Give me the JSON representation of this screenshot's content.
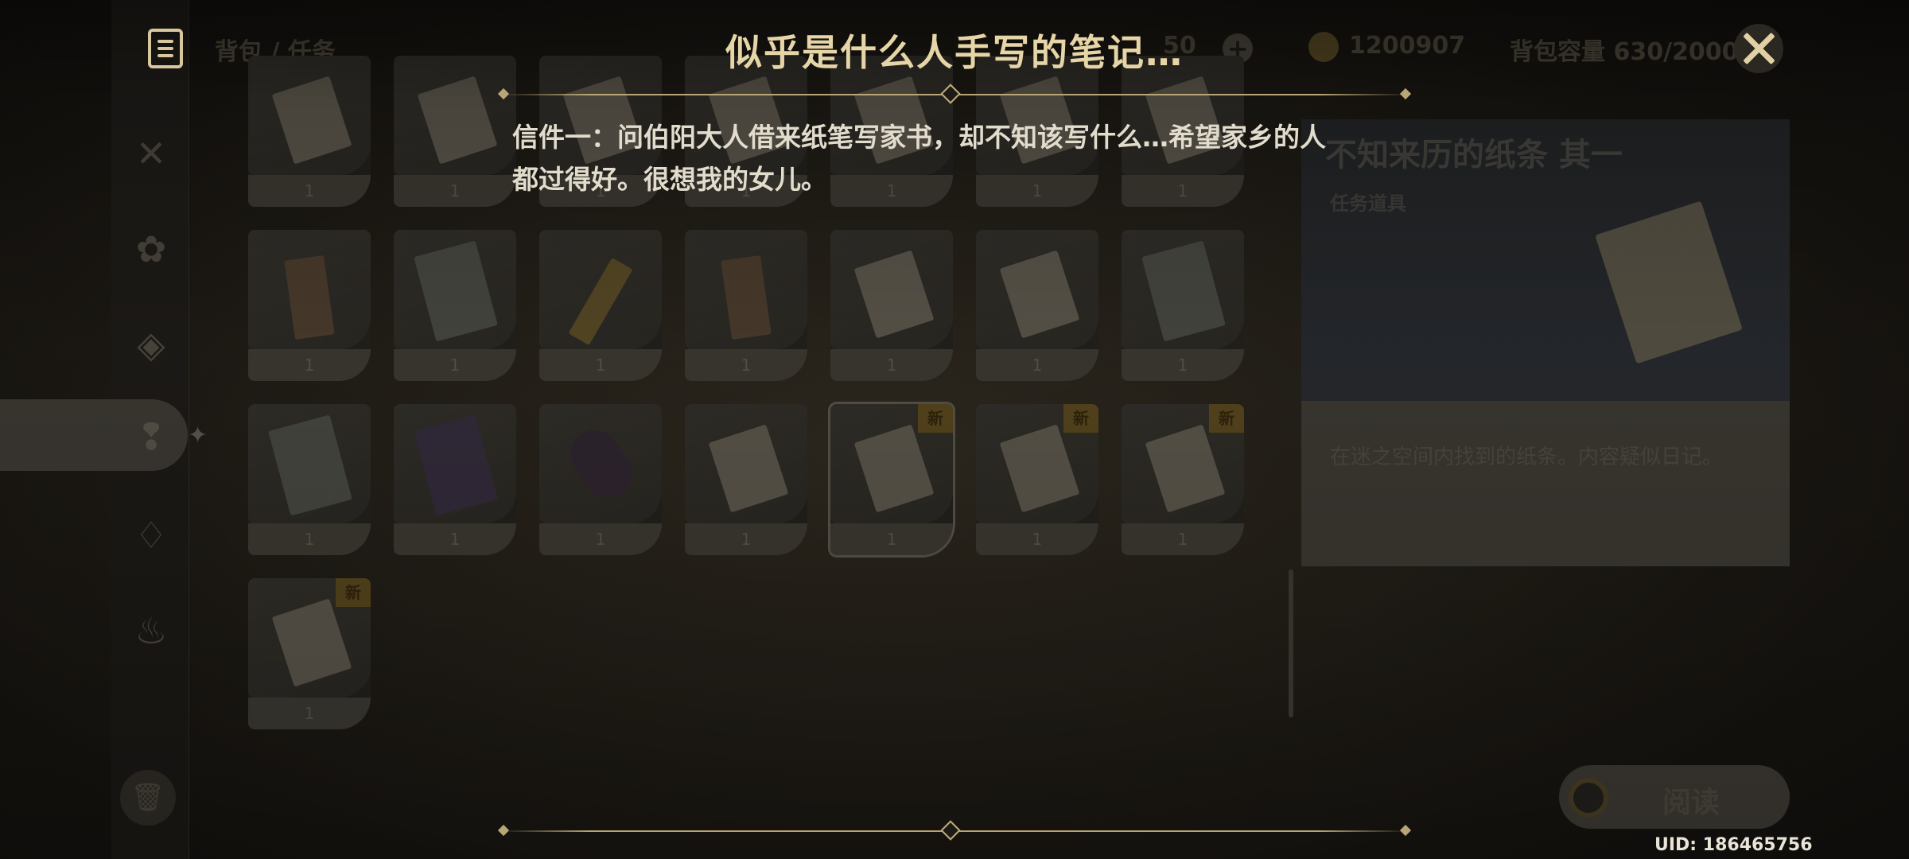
{
  "background": {
    "breadcrumb": "背包 / 任务",
    "currency_amount": "1200907",
    "capacity": "背包容量 630/2000",
    "partial_count": "50",
    "grid": {
      "count_label": "1",
      "new_badge": "新",
      "rows": [
        [
          {
            "icon": "paper",
            "count": "1"
          },
          {
            "icon": "paper",
            "count": "1"
          },
          {
            "icon": "paper",
            "count": "1"
          },
          {
            "icon": "paper",
            "count": "1"
          },
          {
            "icon": "paper",
            "count": "1"
          },
          {
            "icon": "paper",
            "count": "1"
          },
          {
            "icon": "paper",
            "count": "1"
          }
        ],
        [
          {
            "icon": "scroll",
            "count": "1"
          },
          {
            "icon": "card",
            "count": "1"
          },
          {
            "icon": "gold",
            "count": "1"
          },
          {
            "icon": "scroll",
            "count": "1"
          },
          {
            "icon": "paper",
            "count": "1"
          },
          {
            "icon": "paper",
            "count": "1"
          },
          {
            "icon": "card",
            "count": "1"
          }
        ],
        [
          {
            "icon": "card",
            "count": "1"
          },
          {
            "icon": "book",
            "count": "1"
          },
          {
            "icon": "doll",
            "count": "1"
          },
          {
            "icon": "paper",
            "count": "1"
          },
          {
            "icon": "paper",
            "count": "1",
            "new": true,
            "selected": true
          },
          {
            "icon": "paper",
            "count": "1",
            "new": true
          },
          {
            "icon": "paper",
            "count": "1",
            "new": true
          }
        ],
        [
          {
            "icon": "paper",
            "count": "1",
            "new": true
          }
        ]
      ]
    },
    "detail": {
      "title": "不知来历的纸条 其一",
      "subtitle": "任务道具",
      "description": "在迷之空间内找到的纸条。内容疑似日记。"
    },
    "read_button": "阅读"
  },
  "note": {
    "title": "似乎是什么人手写的笔记…",
    "body_line1": "信件一：问伯阳大人借来纸笔写家书，却不知该写什么…希望家乡的人",
    "body_line2": "都过得好。很想我的女儿。"
  },
  "uid": "UID: 186465756",
  "colors": {
    "accent_gold": "#e6d5a6",
    "body_text": "#e2dccd",
    "divider": "#b9a676"
  }
}
